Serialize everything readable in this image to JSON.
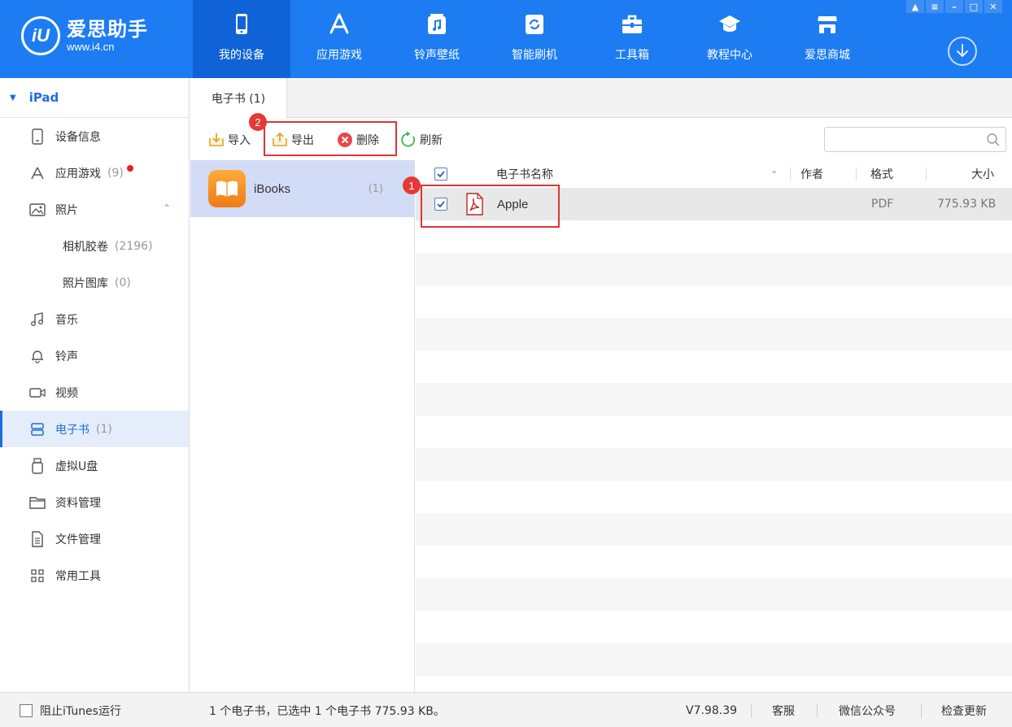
{
  "app": {
    "name": "爱思助手",
    "url": "www.i4.cn",
    "logo_mark": "iU"
  },
  "nav": [
    {
      "label": "我的设备",
      "icon": "phone-icon",
      "active": true
    },
    {
      "label": "应用游戏",
      "icon": "app-store-icon"
    },
    {
      "label": "铃声壁纸",
      "icon": "music-wallpaper-icon"
    },
    {
      "label": "智能刷机",
      "icon": "flash-icon"
    },
    {
      "label": "工具箱",
      "icon": "toolbox-icon"
    },
    {
      "label": "教程中心",
      "icon": "graduation-cap-icon"
    },
    {
      "label": "爱思商城",
      "icon": "shop-icon"
    }
  ],
  "window_controls": [
    "shirt-icon",
    "menu-icon",
    "minimize-icon",
    "maximize-icon",
    "close-icon"
  ],
  "sidebar": {
    "device": "iPad",
    "items": [
      {
        "label": "设备信息",
        "icon": "device-info-icon"
      },
      {
        "label": "应用游戏",
        "count": "(9)",
        "icon": "apps-icon",
        "badge": true
      },
      {
        "label": "照片",
        "icon": "photo-icon",
        "expanded": true
      },
      {
        "label": "相机胶卷",
        "count": "(2196)",
        "sub": true
      },
      {
        "label": "照片图库",
        "count": "(0)",
        "sub": true
      },
      {
        "label": "音乐",
        "icon": "music-icon"
      },
      {
        "label": "铃声",
        "icon": "bell-icon"
      },
      {
        "label": "视频",
        "icon": "video-icon"
      },
      {
        "label": "电子书",
        "count": "(1)",
        "icon": "ebook-icon",
        "active": true
      },
      {
        "label": "虚拟U盘",
        "icon": "usb-icon"
      },
      {
        "label": "资料管理",
        "icon": "folder-icon"
      },
      {
        "label": "文件管理",
        "icon": "file-icon"
      },
      {
        "label": "常用工具",
        "icon": "grid-icon"
      }
    ]
  },
  "tab": {
    "label": "电子书 (1)"
  },
  "toolbar": {
    "import": "导入",
    "export": "导出",
    "delete": "删除",
    "refresh": "刷新",
    "search_placeholder": ""
  },
  "apps": [
    {
      "name": "iBooks",
      "count": "(1)"
    }
  ],
  "table": {
    "columns": {
      "name": "电子书名称",
      "author": "作者",
      "format": "格式",
      "size": "大小"
    },
    "rows": [
      {
        "name": "Apple",
        "author": "",
        "format": "PDF",
        "size": "775.93 KB",
        "checked": true
      }
    ]
  },
  "annotations": [
    {
      "number": "1"
    },
    {
      "number": "2"
    }
  ],
  "status": {
    "block_itunes": "阻止iTunes运行",
    "summary": "1 个电子书，已选中 1 个电子书 775.93 KB。",
    "version": "V7.98.39",
    "support": "客服",
    "wechat": "微信公众号",
    "update": "检查更新"
  },
  "colors": {
    "accent": "#1d7cf2",
    "active_nav": "#0f63d6",
    "selected": "#d3dcf6",
    "annotation": "#e03535"
  }
}
